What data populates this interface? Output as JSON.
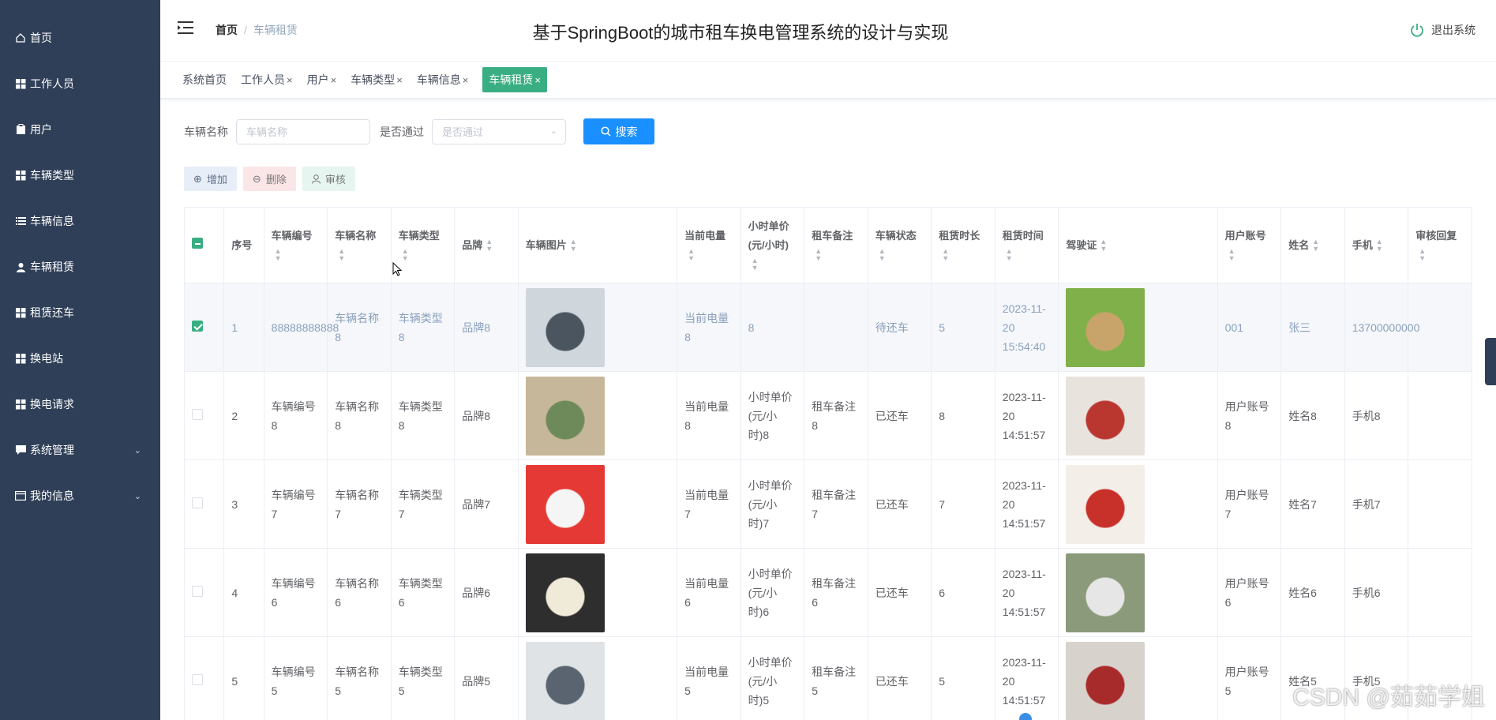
{
  "sidebar": {
    "items": [
      {
        "label": "首页",
        "icon": "home-icon"
      },
      {
        "label": "工作人员",
        "icon": "grid-icon"
      },
      {
        "label": "用户",
        "icon": "clipboard-icon"
      },
      {
        "label": "车辆类型",
        "icon": "grid-icon"
      },
      {
        "label": "车辆信息",
        "icon": "list-icon"
      },
      {
        "label": "车辆租赁",
        "icon": "user-icon"
      },
      {
        "label": "租赁还车",
        "icon": "grid-icon"
      },
      {
        "label": "换电站",
        "icon": "grid-icon"
      },
      {
        "label": "换电请求",
        "icon": "grid-icon"
      },
      {
        "label": "系统管理",
        "icon": "chat-icon"
      },
      {
        "label": "我的信息",
        "icon": "card-icon"
      }
    ]
  },
  "header": {
    "breadcrumb_home": "首页",
    "breadcrumb_sep": "/",
    "breadcrumb_current": "车辆租赁",
    "title": "基于SpringBoot的城市租车换电管理系统的设计与实现",
    "logout": "退出系统"
  },
  "tabs": [
    {
      "label": "系统首页",
      "close": ""
    },
    {
      "label": "工作人员",
      "close": "×"
    },
    {
      "label": "用户",
      "close": "×"
    },
    {
      "label": "车辆类型",
      "close": "×"
    },
    {
      "label": "车辆信息",
      "close": "×"
    },
    {
      "label": "车辆租赁",
      "close": "×"
    }
  ],
  "search": {
    "name_label": "车辆名称",
    "name_placeholder": "车辆名称",
    "pass_label": "是否通过",
    "pass_placeholder": "是否通过",
    "button": "搜索"
  },
  "actions": {
    "add": "增加",
    "delete": "删除",
    "audit": "审核"
  },
  "table": {
    "headers": [
      "序号",
      "车辆编号",
      "车辆名称",
      "车辆类型",
      "品牌",
      "车辆图片",
      "当前电量",
      "小时单价(元/小时)",
      "租车备注",
      "车辆状态",
      "租赁时长",
      "租赁时间",
      "驾驶证",
      "用户账号",
      "姓名",
      "手机",
      "审核回复"
    ],
    "rows": [
      {
        "idx": "1",
        "code": "88888888888",
        "name": "车辆名称8",
        "type": "车辆类型8",
        "brand": "品牌8",
        "power": "当前电量8",
        "price": "8",
        "note": "",
        "status": "待还车",
        "duration": "5",
        "time": "2023-11-20 15:54:40",
        "account": "001",
        "uname": "张三",
        "phone": "13700000000",
        "reply": "",
        "checked": true
      },
      {
        "idx": "2",
        "code": "车辆编号8",
        "name": "车辆名称8",
        "type": "车辆类型8",
        "brand": "品牌8",
        "power": "当前电量8",
        "price": "小时单价(元/小时)8",
        "note": "租车备注8",
        "status": "已还车",
        "duration": "8",
        "time": "2023-11-20 14:51:57",
        "account": "用户账号8",
        "uname": "姓名8",
        "phone": "手机8",
        "reply": "",
        "checked": false
      },
      {
        "idx": "3",
        "code": "车辆编号7",
        "name": "车辆名称7",
        "type": "车辆类型7",
        "brand": "品牌7",
        "power": "当前电量7",
        "price": "小时单价(元/小时)7",
        "note": "租车备注7",
        "status": "已还车",
        "duration": "7",
        "time": "2023-11-20 14:51:57",
        "account": "用户账号7",
        "uname": "姓名7",
        "phone": "手机7",
        "reply": "",
        "checked": false
      },
      {
        "idx": "4",
        "code": "车辆编号6",
        "name": "车辆名称6",
        "type": "车辆类型6",
        "brand": "品牌6",
        "power": "当前电量6",
        "price": "小时单价(元/小时)6",
        "note": "租车备注6",
        "status": "已还车",
        "duration": "6",
        "time": "2023-11-20 14:51:57",
        "account": "用户账号6",
        "uname": "姓名6",
        "phone": "手机6",
        "reply": "",
        "checked": false
      },
      {
        "idx": "5",
        "code": "车辆编号5",
        "name": "车辆名称5",
        "type": "车辆类型5",
        "brand": "品牌5",
        "power": "当前电量5",
        "price": "小时单价(元/小时)5",
        "note": "租车备注5",
        "status": "已还车",
        "duration": "5",
        "time": "2023-11-20 14:51:57",
        "account": "用户账号5",
        "uname": "姓名5",
        "phone": "手机5",
        "reply": "",
        "checked": false
      }
    ]
  },
  "watermark": "CSDN @茹茹学姐",
  "colors": {
    "sidebar": "#2f3f58",
    "accent": "#3aae83",
    "primary": "#1a8fff"
  }
}
